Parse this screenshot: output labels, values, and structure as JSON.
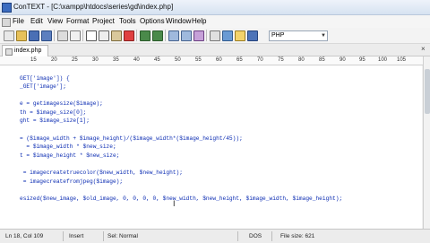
{
  "window": {
    "title": "ConTEXT - [C:\\xampp\\htdocs\\series\\gd\\index.php]"
  },
  "menu": [
    "File",
    "Edit",
    "View",
    "Format",
    "Project",
    "Tools",
    "Options",
    "Window",
    "Help"
  ],
  "toolbar": {
    "language": "PHP"
  },
  "tab": {
    "label": "index.php"
  },
  "ruler": [
    "15",
    "20",
    "25",
    "30",
    "35",
    "40",
    "45",
    "50",
    "55",
    "60",
    "65",
    "70",
    "75",
    "80",
    "85",
    "90",
    "95",
    "100",
    "105"
  ],
  "code": [
    "GET['image']) {",
    "_GET['image'];",
    "",
    "e = getimagesize($image);",
    "th = $image_size[0];",
    "ght = $image_size[1];",
    "",
    "= ($image_width + $image_height)/($image_width*($image_height/45));",
    "  = $image_width * $new_size;",
    "t = $image_height * $new_size;",
    "",
    " = imagecreatetruecolor($new_width, $new_height);",
    " = imagecreatefromjpeg($image);",
    "",
    "esized($new_image, $old_image, 0, 0, 0, 0, $new_width, $new_height, $image_width, $image_height);"
  ],
  "status": {
    "position": "Ln 18, Col 109",
    "mode": "Insert",
    "selection": "Sel: Normal",
    "format": "DOS",
    "filesize": "File size: 621"
  }
}
